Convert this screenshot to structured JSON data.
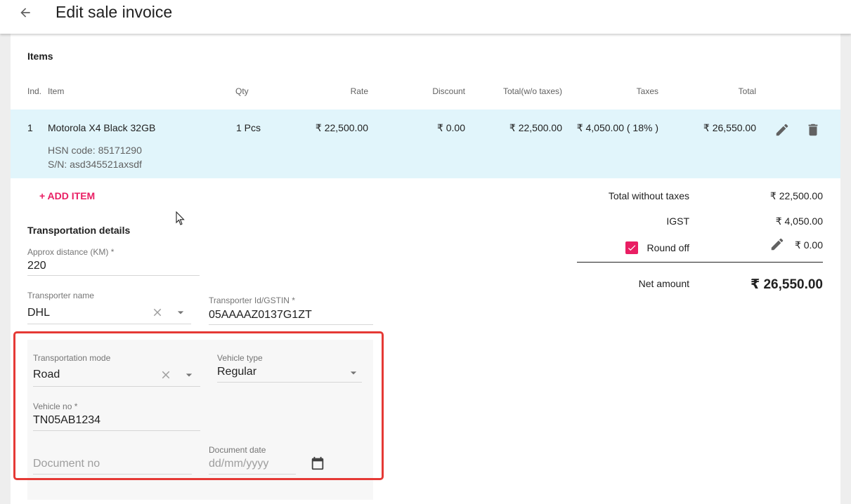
{
  "header": {
    "title": "Edit sale invoice"
  },
  "items_section": {
    "title": "Items",
    "columns": [
      "Ind.",
      "Item",
      "Qty",
      "Rate",
      "Discount",
      "Total(w/o taxes)",
      "Taxes",
      "Total"
    ],
    "rows": [
      {
        "index": "1",
        "name": "Motorola X4 Black 32GB",
        "hsn": "HSN code: 85171290",
        "serial": "S/N:  asd345521axsdf",
        "qty": "1 Pcs",
        "rate": "₹ 22,500.00",
        "discount": "₹ 0.00",
        "total_wo_taxes": "₹ 22,500.00",
        "taxes": "₹ 4,050.00 ( 18% )",
        "total": "₹ 26,550.00"
      }
    ],
    "add_item_label": "+ ADD ITEM"
  },
  "summary": {
    "total_without_taxes_label": "Total without taxes",
    "total_without_taxes_value": "₹ 22,500.00",
    "igst_label": "IGST",
    "igst_value": "₹ 4,050.00",
    "round_off_label": "Round off",
    "round_off_checked": true,
    "round_off_value": "₹ 0.00",
    "net_amount_label": "Net amount",
    "net_amount_value": "₹ 26,550.00"
  },
  "transportation": {
    "title": "Transportation details",
    "distance_label": "Approx distance (KM) *",
    "distance_value": "220",
    "transporter_name_label": "Transporter name",
    "transporter_name_value": "DHL",
    "transporter_id_label": "Transporter Id/GSTIN *",
    "transporter_id_value": "05AAAAZ0137G1ZT",
    "mode_label": "Transportation mode",
    "mode_value": "Road",
    "vehicle_type_label": "Vehicle type",
    "vehicle_type_value": "Regular",
    "vehicle_no_label": "Vehicle no *",
    "vehicle_no_value": "TN05AB1234",
    "document_no_placeholder": "Document no",
    "document_date_label": "Document date",
    "document_date_placeholder": "dd/mm/yyyy"
  },
  "colors": {
    "accent": "#e91e63",
    "row_highlight": "#e1f5fb",
    "annotation_border": "#e53935"
  }
}
